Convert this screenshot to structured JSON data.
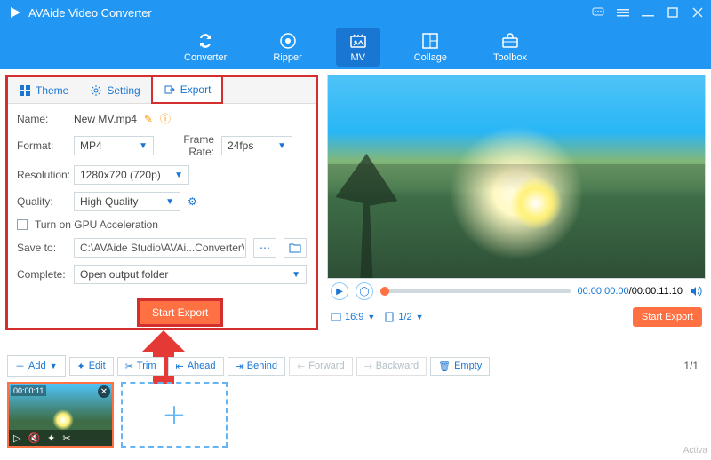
{
  "app": {
    "title": "AVAide Video Converter"
  },
  "nav": {
    "items": [
      {
        "label": "Converter"
      },
      {
        "label": "Ripper"
      },
      {
        "label": "MV"
      },
      {
        "label": "Collage"
      },
      {
        "label": "Toolbox"
      }
    ]
  },
  "tabs": {
    "theme": "Theme",
    "setting": "Setting",
    "export": "Export"
  },
  "form": {
    "name_label": "Name:",
    "name_value": "New MV.mp4",
    "format_label": "Format:",
    "format_value": "MP4",
    "framerate_label": "Frame Rate:",
    "framerate_value": "24fps",
    "resolution_label": "Resolution:",
    "resolution_value": "1280x720 (720p)",
    "quality_label": "Quality:",
    "quality_value": "High Quality",
    "gpu_label": "Turn on GPU Acceleration",
    "saveto_label": "Save to:",
    "saveto_value": "C:\\AVAide Studio\\AVAi...Converter\\MV Exported",
    "complete_label": "Complete:",
    "complete_value": "Open output folder"
  },
  "preview": {
    "time_current": "00:00:00.00",
    "time_total": "00:00:11.10",
    "aspect": "16:9",
    "page": "1/2",
    "start_export": "Start Export"
  },
  "center_button": "Start Export",
  "toolbar": {
    "add": "Add",
    "edit": "Edit",
    "trim": "Trim",
    "ahead": "Ahead",
    "behind": "Behind",
    "forward": "Forward",
    "backward": "Backward",
    "empty": "Empty",
    "pages": "1/1"
  },
  "thumb": {
    "duration": "00:00:11"
  },
  "watermark": {
    "l1": "Activa",
    "l2": ""
  }
}
